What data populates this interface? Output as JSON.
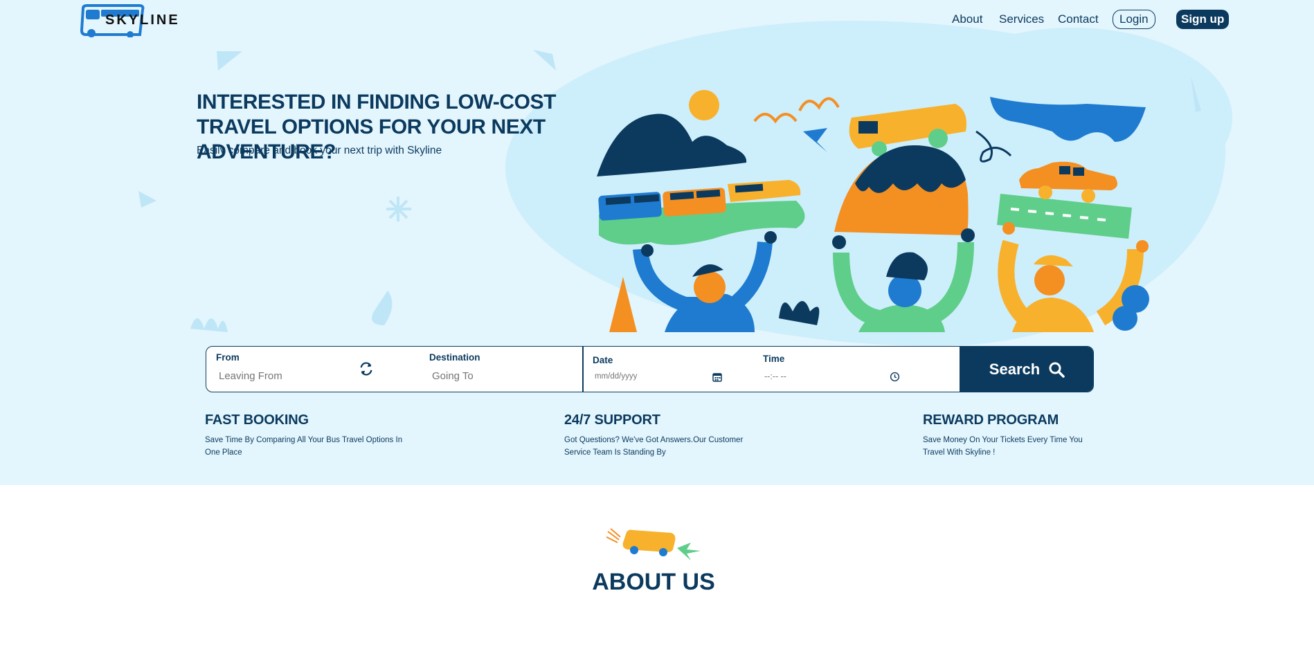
{
  "brand": {
    "name": "SKYLINE"
  },
  "nav": {
    "about": "About",
    "services": "Services",
    "contact": "Contact",
    "login": "Login",
    "signup": "Sign up"
  },
  "hero": {
    "headline": "INTERESTED IN FINDING LOW-COST TRAVEL OPTIONS FOR YOUR NEXT ADVENTURE?",
    "subline": "Easily compare and book your next trip with Skyline"
  },
  "search": {
    "from_label": "From",
    "from_placeholder": "Leaving From",
    "destination_label": "Destination",
    "destination_placeholder": "Going To",
    "date_label": "Date",
    "date_placeholder": "mm/dd/yyyy",
    "time_label": "Time",
    "time_placeholder": "--:-- --",
    "button_label": "Search"
  },
  "features": [
    {
      "title": "FAST BOOKING",
      "text": "Save Time By Comparing All Your Bus Travel Options In One Place"
    },
    {
      "title": "24/7 SUPPORT",
      "text": "Got Questions? We've Got Answers.Our Customer Service Team Is Standing By"
    },
    {
      "title": "REWARD PROGRAM",
      "text": "Save Money On Your Tickets Every Time You Travel With Skyline !"
    }
  ],
  "about": {
    "title": "ABOUT US"
  },
  "colors": {
    "navy": "#0b3a5e",
    "hero_bg": "#e3f5fd",
    "blue": "#1e7bd0",
    "orange": "#f48f22",
    "yellow": "#f8b12c",
    "green": "#5fce8a"
  }
}
